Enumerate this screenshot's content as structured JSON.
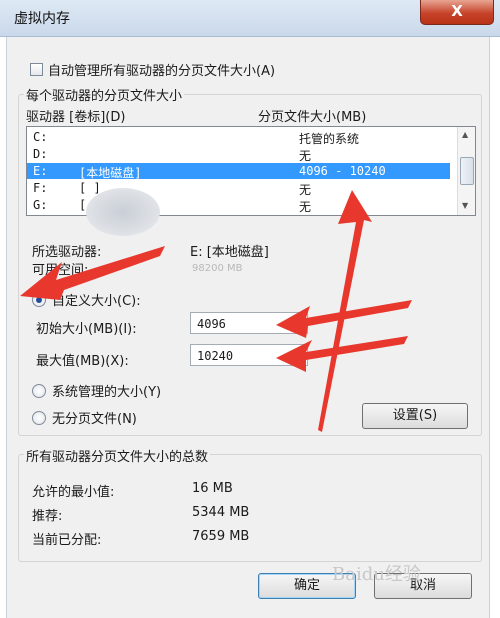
{
  "window": {
    "title": "虚拟内存",
    "close_label": "X"
  },
  "auto_manage": {
    "label": "自动管理所有驱动器的分页文件大小(A)",
    "checked": false
  },
  "per_drive": {
    "legend": "每个驱动器的分页文件大小",
    "col_drive": "驱动器 [卷标](D)",
    "col_size": "分页文件大小(MB)",
    "rows": [
      {
        "drive": "C:",
        "label": "",
        "size": "托管的系统"
      },
      {
        "drive": "D:",
        "label": "",
        "size": "无"
      },
      {
        "drive": "E:",
        "label": "[本地磁盘]",
        "size": "4096 - 10240"
      },
      {
        "drive": "F:",
        "label": "[        ]",
        "size": "无"
      },
      {
        "drive": "G:",
        "label": "[   ]",
        "size": "无"
      }
    ],
    "selected_index": 2,
    "selected_drive_label": "所选驱动器:",
    "selected_drive_value": "E:  [本地磁盘]",
    "free_space_label": "可用空间:",
    "free_space_value": "98200 MB",
    "custom_size_label": "自定义大小(C):",
    "initial_size_label": "初始大小(MB)(I):",
    "initial_size_value": "4096",
    "max_size_label": "最大值(MB)(X):",
    "max_size_value": "10240",
    "system_managed_label": "系统管理的大小(Y)",
    "no_paging_label": "无分页文件(N)",
    "set_button": "设置(S)",
    "selected_option": "custom"
  },
  "totals": {
    "legend": "所有驱动器分页文件大小的总数",
    "min_label": "允许的最小值:",
    "min_value": "16 MB",
    "recommended_label": "推荐:",
    "recommended_value": "5344 MB",
    "allocated_label": "当前已分配:",
    "allocated_value": "7659 MB"
  },
  "footer": {
    "ok_label": "确定",
    "cancel_label": "取消"
  },
  "colors": {
    "selection": "#3399ff",
    "arrow": "#e8382e",
    "close": "#c7432a"
  },
  "watermark": {
    "text": "Baidu经验"
  }
}
